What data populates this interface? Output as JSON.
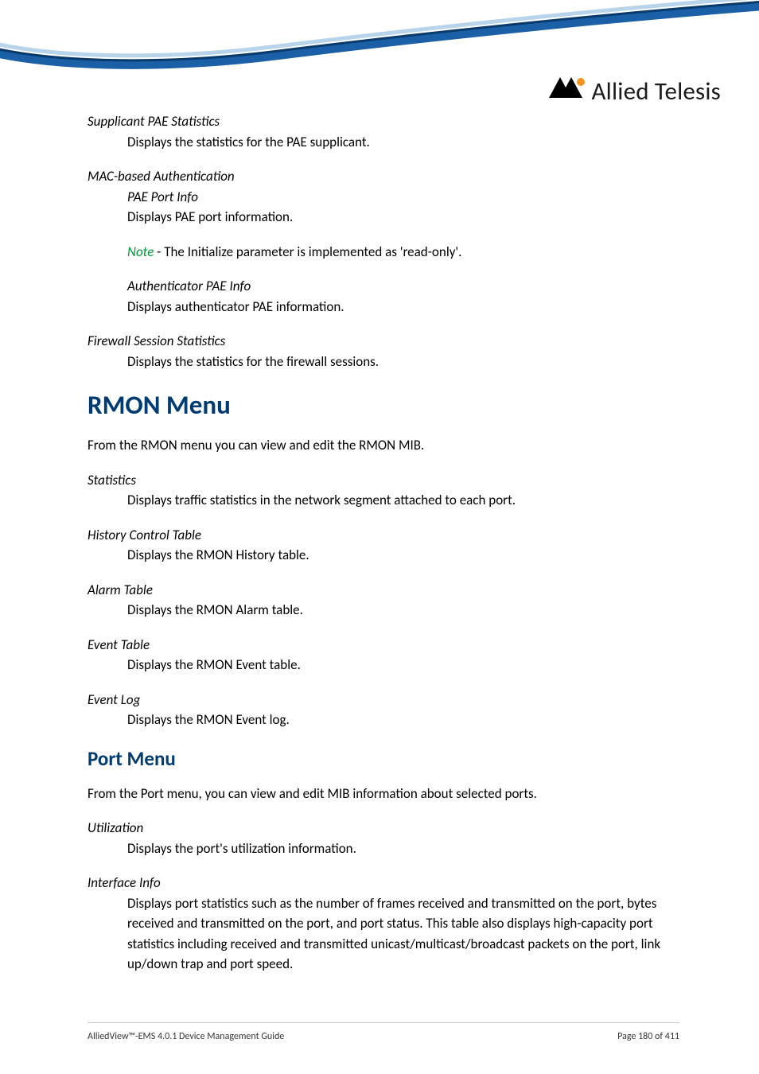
{
  "logo_text": "Allied Telesis",
  "sections": {
    "supplicant_title": "Supplicant PAE Statistics",
    "supplicant_desc": "Displays the statistics for the PAE supplicant.",
    "mac_title": "MAC-based Authentication",
    "mac_pae_title": "PAE Port Info",
    "mac_pae_desc": "Displays PAE port information.",
    "note_label": "Note",
    "note_text": " - The Initialize parameter is implemented as 'read-only'.",
    "auth_title": "Authenticator PAE Info",
    "auth_desc": "Displays authenticator PAE information.",
    "firewall_title": "Firewall Session Statistics",
    "firewall_desc": "Displays the statistics for the firewall sessions.",
    "rmon_heading": "RMON Menu",
    "rmon_intro": "From the RMON menu you can view and edit the RMON MIB.",
    "stats_title": "Statistics",
    "stats_desc": "Displays traffic statistics in the network segment attached to each port.",
    "history_title": "History Control Table",
    "history_desc": "Displays the RMON History table.",
    "alarm_title": "Alarm Table",
    "alarm_desc": "Displays the RMON Alarm table.",
    "event_title": "Event Table",
    "event_desc": "Displays the RMON Event table.",
    "log_title": "Event Log",
    "log_desc": "Displays the RMON Event log.",
    "port_heading": "Port Menu",
    "port_intro": "From the Port menu, you can view and edit MIB information about selected ports.",
    "util_title": "Utilization",
    "util_desc": "Displays the port's utilization information.",
    "iface_title": "Interface Info",
    "iface_desc": "Displays port statistics such as the number of frames received and transmitted on the port, bytes received and transmitted on the port, and port status. This table also displays high-capacity port statistics including received and transmitted unicast/multicast/broadcast packets on the port, link up/down trap and port speed."
  },
  "footer": {
    "left": "AlliedView™-EMS 4.0.1 Device Management Guide",
    "right": "Page 180 of 411"
  }
}
